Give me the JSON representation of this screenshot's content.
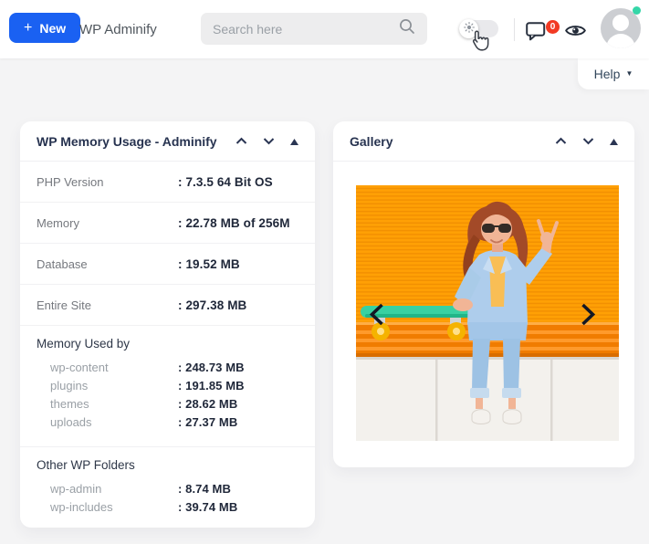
{
  "topbar": {
    "new_button": "New",
    "brand": "WP Adminify",
    "search_placeholder": "Search here",
    "notification_count": "0",
    "help_label": "Help"
  },
  "glyphs": {
    "plus": "+",
    "caret_down": "▼"
  },
  "memory_card": {
    "title": "WP Memory Usage - Adminify",
    "rows": [
      {
        "label": "PHP Version",
        "value": ": 7.3.5 64 Bit OS"
      },
      {
        "label": "Memory",
        "value": ": 22.78 MB of 256M"
      },
      {
        "label": "Database",
        "value": ": 19.52 MB"
      },
      {
        "label": "Entire Site",
        "value": ": 297.38 MB"
      }
    ],
    "sections": [
      {
        "title": "Memory Used by",
        "rows": [
          {
            "label": "wp-content",
            "value": ": 248.73 MB"
          },
          {
            "label": "plugins",
            "value": ": 191.85 MB"
          },
          {
            "label": "themes",
            "value": ": 28.62 MB"
          },
          {
            "label": "uploads",
            "value": ": 27.37 MB"
          }
        ]
      },
      {
        "title": "Other WP Folders",
        "rows": [
          {
            "label": "wp-admin",
            "value": ": 8.74 MB"
          },
          {
            "label": "wp-includes",
            "value": ": 39.74 MB"
          }
        ]
      }
    ]
  },
  "gallery_card": {
    "title": "Gallery"
  },
  "colors": {
    "accent_blue": "#1a61f2",
    "badge_red": "#f23a23",
    "online_green": "#35d6a8",
    "title_navy": "#273350",
    "photo_orange": "#ffa000",
    "skateboard_green": "#38d1a2"
  }
}
